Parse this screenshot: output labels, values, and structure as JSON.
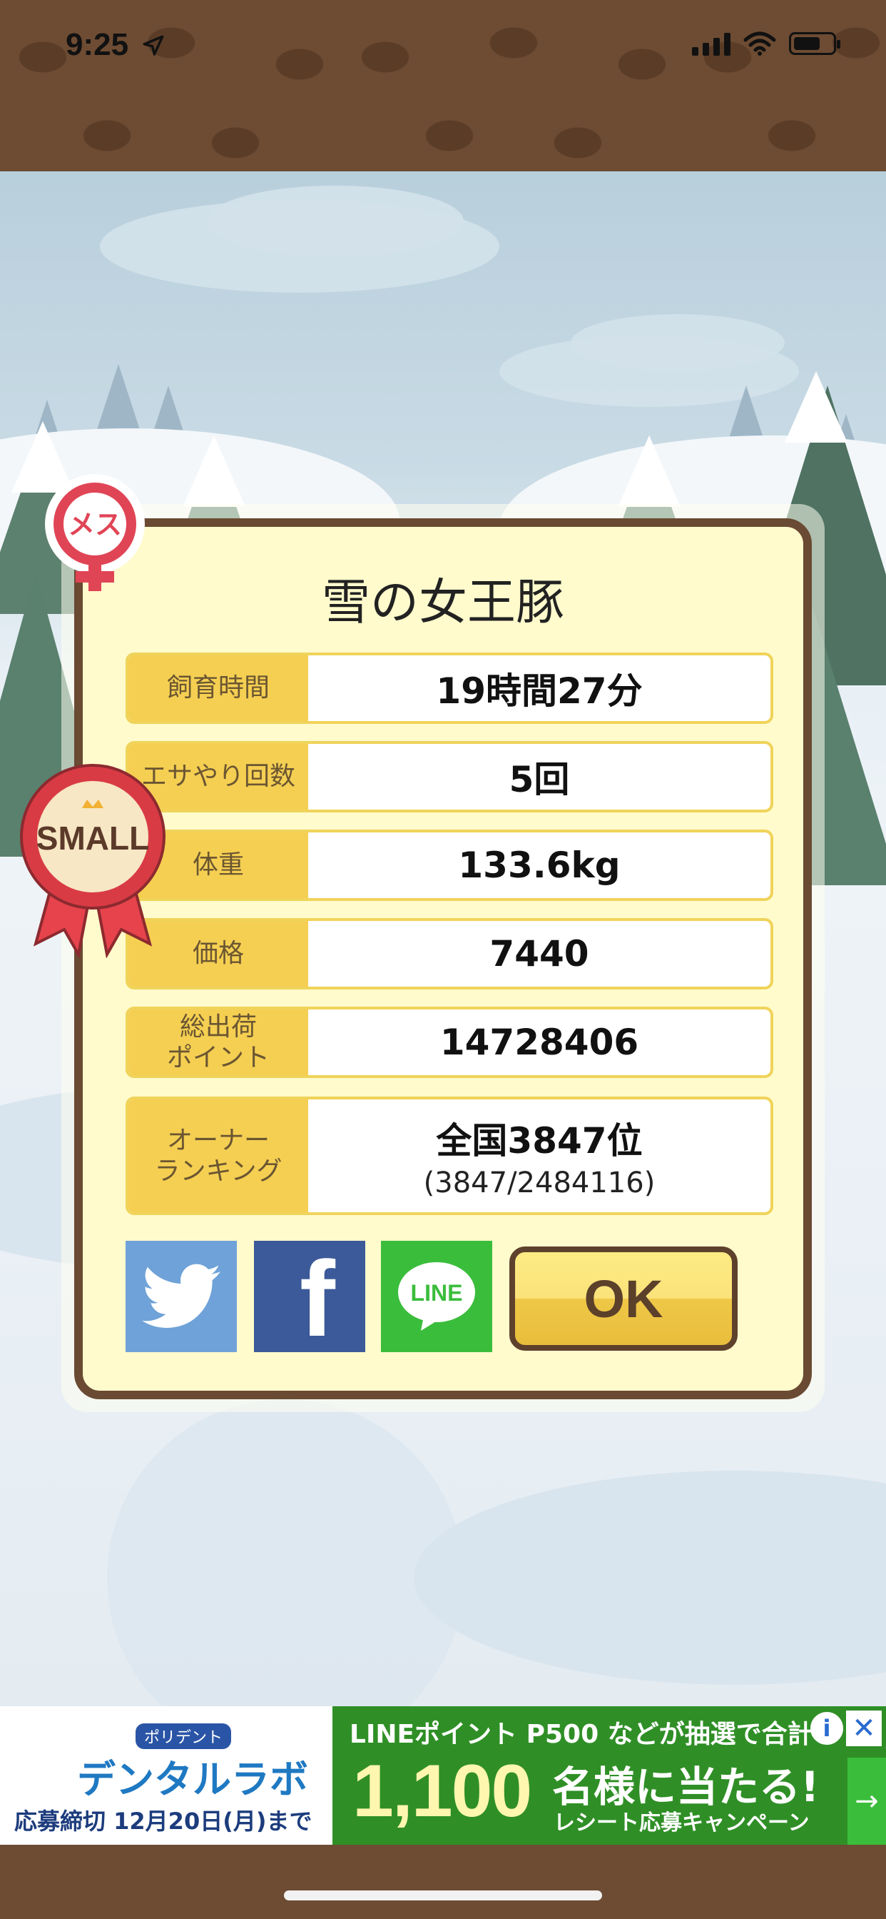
{
  "status_bar": {
    "time": "9:25"
  },
  "dialog": {
    "title": "雪の女王豚",
    "rows": [
      {
        "label": "飼育時間",
        "value": "19時間27分"
      },
      {
        "label": "エサやり回数",
        "value": "5回"
      },
      {
        "label": "体重",
        "value": "133.6kg"
      },
      {
        "label": "価格",
        "value": "7440"
      },
      {
        "label": "総出荷\nポイント",
        "value": "14728406"
      },
      {
        "label": "オーナー\nランキング",
        "value": "全国3847位",
        "sub": "(3847/2484116)"
      }
    ],
    "ok_label": "OK",
    "line_label": "LINE",
    "facebook_label": "f"
  },
  "badges": {
    "female": "メス",
    "size": "SMALL"
  },
  "ad": {
    "brand_small": "ポリデント",
    "brand": "デンタルラボ",
    "deadline": "応募締切 12月20日(月)まで",
    "line1": "LINEポイント P500 などが抽選で合計",
    "big_number": "1,100",
    "win_text": "名様に当たる!",
    "campaign": "レシート応募キャンペーン",
    "info": "i",
    "close": "✕",
    "arrow": "→"
  },
  "colors": {
    "brown": "#6a4a33",
    "dialog_bg": "#fffbcc",
    "label_bg": "#f5cf52",
    "twitter": "#6fa2d8",
    "facebook": "#3c5a99",
    "line": "#3bbd3c"
  },
  "icons": {
    "status": [
      "location-arrow-icon",
      "signal-icon",
      "wifi-icon",
      "battery-icon"
    ],
    "share": [
      "twitter-bird-icon",
      "facebook-icon",
      "line-icon"
    ]
  }
}
